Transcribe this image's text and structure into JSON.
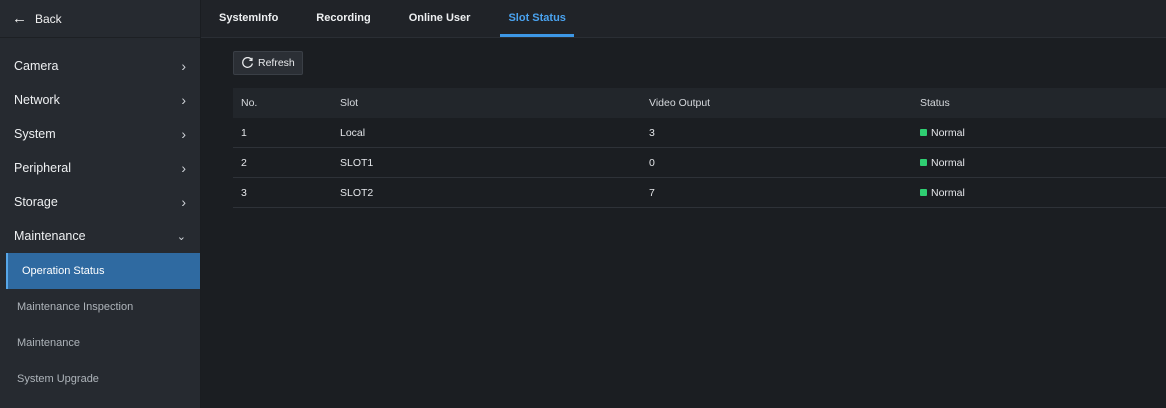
{
  "sidebar": {
    "back_label": "Back",
    "menu": [
      {
        "label": "Camera"
      },
      {
        "label": "Network"
      },
      {
        "label": "System"
      },
      {
        "label": "Peripheral"
      },
      {
        "label": "Storage"
      },
      {
        "label": "Maintenance"
      }
    ],
    "sub_items": [
      {
        "label": "Operation Status"
      },
      {
        "label": "Maintenance Inspection"
      },
      {
        "label": "Maintenance"
      },
      {
        "label": "System Upgrade"
      }
    ]
  },
  "tabs": [
    {
      "label": "SystemInfo"
    },
    {
      "label": "Recording"
    },
    {
      "label": "Online User"
    },
    {
      "label": "Slot Status"
    }
  ],
  "active_tab": "Slot Status",
  "toolbar": {
    "refresh_label": "Refresh"
  },
  "table": {
    "headers": [
      "No.",
      "Slot",
      "Video Output",
      "Status"
    ],
    "rows": [
      [
        "1",
        "Local",
        "3",
        "Normal"
      ],
      [
        "2",
        "SLOT1",
        "0",
        "Normal"
      ],
      [
        "3",
        "SLOT2",
        "7",
        "Normal"
      ]
    ]
  },
  "colors": {
    "accent": "#3d97e6",
    "active_menu_bg": "#2f6aa1",
    "status_normal": "#2fcf72"
  }
}
